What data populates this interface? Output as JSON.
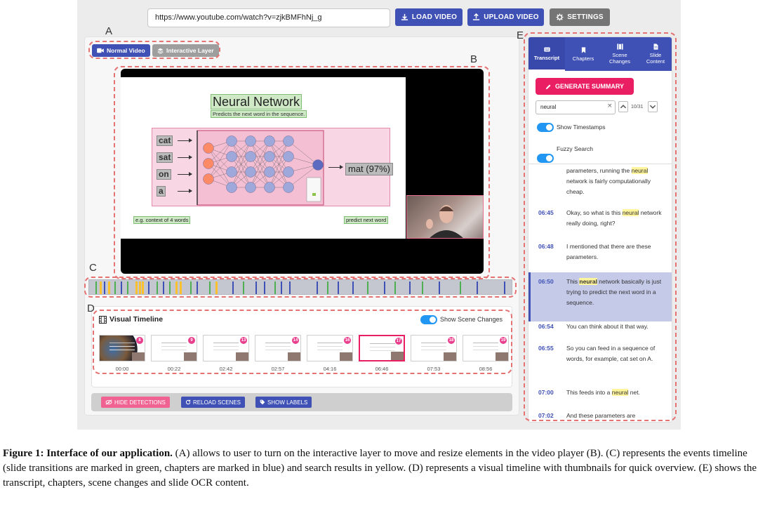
{
  "toolbar": {
    "url": "https://www.youtube.com/watch?v=zjkBMFhNj_g",
    "load_label": "LOAD VIDEO",
    "upload_label": "UPLOAD VIDEO",
    "settings_label": "SETTINGS"
  },
  "modes": {
    "normal": "Normal Video",
    "interactive": "Interactive Layer"
  },
  "slide": {
    "title": "Neural Network",
    "subtitle": "Predicts the next word in the sequence.",
    "inputs": [
      "cat",
      "sat",
      "on",
      "a"
    ],
    "prediction": "mat (97%)",
    "note_left": "e.g. context of 4 words",
    "note_right": "predict next word"
  },
  "visual_timeline": {
    "title": "Visual Timeline",
    "toggle_label": "Show Scene Changes",
    "thumbs": [
      {
        "badge": "8",
        "time": "00:00"
      },
      {
        "badge": "9",
        "time": "00:22"
      },
      {
        "badge": "13",
        "time": "02:42"
      },
      {
        "badge": "14",
        "time": "02:57"
      },
      {
        "badge": "16",
        "time": "04:16"
      },
      {
        "badge": "17",
        "time": "06:46"
      },
      {
        "badge": "18",
        "time": "07:53"
      },
      {
        "badge": "19",
        "time": "08:56"
      }
    ]
  },
  "bottom_bar": {
    "hide_label": "HIDE DETECTIONS",
    "reload_label": "RELOAD SCENES",
    "labels_label": "SHOW LABELS"
  },
  "right_panel": {
    "tabs": [
      "Transcript",
      "Chapters",
      "Scene\nChanges",
      "Slide\nContent"
    ],
    "generate_label": "GENERATE SUMMARY",
    "search_value": "neural",
    "search_count": "10/31",
    "toggle_timestamps": "Show Timestamps",
    "toggle_fuzzy": "Fuzzy Search",
    "segments": [
      {
        "time": "",
        "pre": "parameters, running the ",
        "hit": "neural",
        "post": " network is fairly computationally cheap."
      },
      {
        "time": "06:45",
        "pre": "Okay, so what is this ",
        "hit": "neural",
        "post": " network really doing, right?"
      },
      {
        "time": "06:48",
        "pre": "I mentioned that there are these parameters.",
        "hit": "",
        "post": ""
      },
      {
        "time": "06:50",
        "pre": "This ",
        "hit": "neural",
        "post": " network basically is just trying to predict the next word in a sequence."
      },
      {
        "time": "06:54",
        "pre": "You can think about it that way.",
        "hit": "",
        "post": ""
      },
      {
        "time": "06:55",
        "pre": "So you can feed in a sequence of words, for example, cat set on A.",
        "hit": "",
        "post": ""
      },
      {
        "time": "07:00",
        "pre": "This feeds into a ",
        "hit": "neural",
        "post": " net."
      },
      {
        "time": "07:02",
        "pre": "And these parameters are",
        "hit": "",
        "post": ""
      }
    ]
  },
  "region_labels": [
    "A",
    "B",
    "C",
    "D",
    "E"
  ],
  "events_timeline": {
    "ticks": [
      {
        "pos": 0.015,
        "type": "green"
      },
      {
        "pos": 0.025,
        "type": "search"
      },
      {
        "pos": 0.035,
        "type": "blue"
      },
      {
        "pos": 0.045,
        "type": "search"
      },
      {
        "pos": 0.06,
        "type": "green"
      },
      {
        "pos": 0.075,
        "type": "blue"
      },
      {
        "pos": 0.09,
        "type": "green"
      },
      {
        "pos": 0.11,
        "type": "search"
      },
      {
        "pos": 0.118,
        "type": "search"
      },
      {
        "pos": 0.125,
        "type": "search"
      },
      {
        "pos": 0.14,
        "type": "blue"
      },
      {
        "pos": 0.16,
        "type": "green"
      },
      {
        "pos": 0.175,
        "type": "blue"
      },
      {
        "pos": 0.19,
        "type": "green"
      },
      {
        "pos": 0.205,
        "type": "search"
      },
      {
        "pos": 0.215,
        "type": "search"
      },
      {
        "pos": 0.24,
        "type": "green"
      },
      {
        "pos": 0.255,
        "type": "blue"
      },
      {
        "pos": 0.285,
        "type": "green"
      },
      {
        "pos": 0.3,
        "type": "search"
      },
      {
        "pos": 0.34,
        "type": "blue"
      },
      {
        "pos": 0.365,
        "type": "green"
      },
      {
        "pos": 0.395,
        "type": "blue"
      },
      {
        "pos": 0.415,
        "type": "blue"
      },
      {
        "pos": 0.44,
        "type": "green"
      },
      {
        "pos": 0.455,
        "type": "blue"
      },
      {
        "pos": 0.475,
        "type": "blue"
      },
      {
        "pos": 0.54,
        "type": "blue"
      },
      {
        "pos": 0.565,
        "type": "green"
      },
      {
        "pos": 0.59,
        "type": "blue"
      },
      {
        "pos": 0.625,
        "type": "blue"
      },
      {
        "pos": 0.66,
        "type": "green"
      },
      {
        "pos": 0.7,
        "type": "blue"
      },
      {
        "pos": 0.725,
        "type": "green"
      },
      {
        "pos": 0.76,
        "type": "blue"
      },
      {
        "pos": 0.79,
        "type": "green"
      },
      {
        "pos": 0.83,
        "type": "blue"
      },
      {
        "pos": 0.88,
        "type": "green"
      },
      {
        "pos": 0.92,
        "type": "blue"
      },
      {
        "pos": 0.985,
        "type": "blue"
      }
    ]
  },
  "colors": {
    "primary": "#3f51b5",
    "accent": "#e91e63",
    "toggle": "#2196f3",
    "slide_transition": "#4caf50",
    "chapter": "#3f51b5",
    "search_hit": "#fbc02d",
    "dash": "#e57373"
  },
  "caption": {
    "label": "Figure 1: Interface of our application.",
    "text": "(A) allows to user to turn on the interactive layer to move and resize elements in the video player (B). (C) represents the events timeline (slide transitions are marked in green, chapters are marked in blue) and search results in yellow. (D) represents a visual timeline with thumbnails for quick overview. (E) shows the transcript, chapters, scene changes and slide OCR content."
  }
}
